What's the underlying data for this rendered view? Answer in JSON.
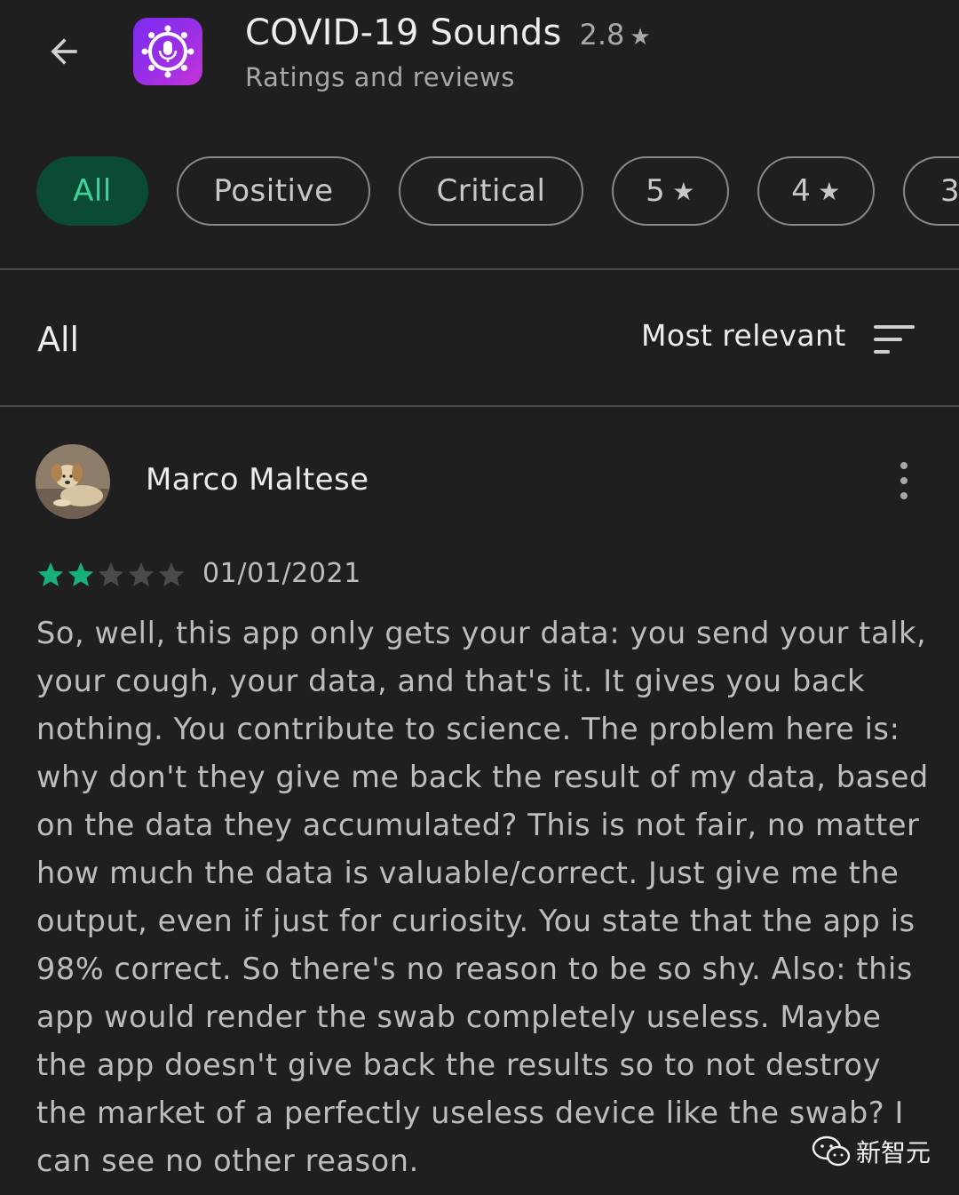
{
  "header": {
    "back_icon": "arrow-left-icon",
    "app_icon": "microphone-virus-icon",
    "app_title": "COVID-19 Sounds",
    "rating": "2.8",
    "rating_star": "★",
    "subtitle": "Ratings and reviews"
  },
  "chips": [
    {
      "label": "All",
      "active": true
    },
    {
      "label": "Positive"
    },
    {
      "label": "Critical"
    },
    {
      "label": "5",
      "star": "★"
    },
    {
      "label": "4",
      "star": "★"
    },
    {
      "label": "3"
    }
  ],
  "filter_bar": {
    "current_filter": "All",
    "sort_label": "Most relevant",
    "sort_icon": "sort-icon"
  },
  "review": {
    "author": "Marco Maltese",
    "avatar": "dog-photo",
    "stars_filled": 2,
    "stars_total": 5,
    "date": "01/01/2021",
    "lines": [
      "So, well, this app only gets your data: you send your talk,",
      "your cough, your data, and that's it. It gives you back",
      "nothing. You contribute to science. The problem here is:",
      "why don't they give me back the result of my data, based",
      "on the data they accumulated? This is not fair, no matter",
      "how much the data is valuable/correct. Just give me the",
      "output, even if just for curiosity. You state that the app is",
      "98% correct. So there's no reason to be so shy. Also: this",
      "app would render the swab completely useless. Maybe",
      "the app doesn't give back the results so to not destroy",
      "the market of a perfectly useless device like the swab? I",
      "can see no other reason."
    ]
  },
  "watermark": {
    "text": "新智元",
    "icon": "wechat-icon"
  },
  "colors": {
    "background": "#1f1f1f",
    "accent_green": "#3dd39b",
    "chip_active_bg": "#0b4a35",
    "star_filled": "#17b07a",
    "star_empty": "#4a4a4a"
  }
}
